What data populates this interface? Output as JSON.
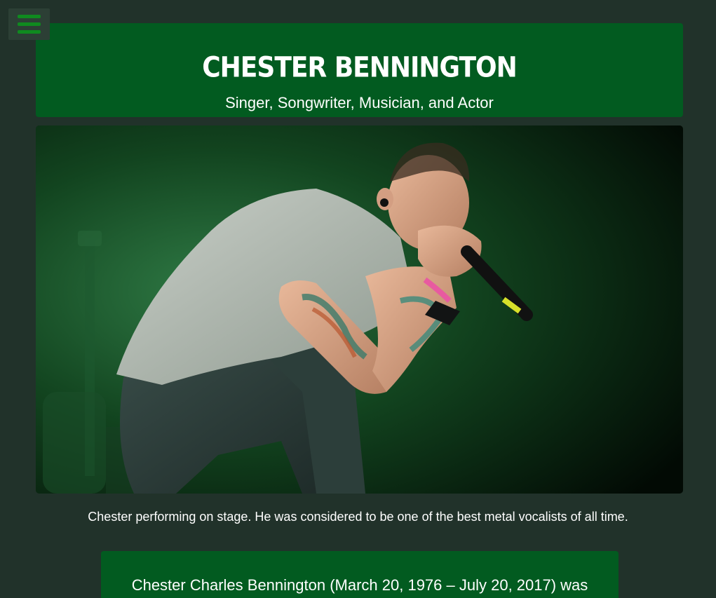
{
  "menu": {
    "icon": "hamburger-menu-icon",
    "accent_color": "#0f8a1f"
  },
  "header": {
    "title": "CHESTER BENNINGTON",
    "subtitle": "Singer, Songwriter, Musician, and Actor",
    "background_color": "#025b20"
  },
  "photo": {
    "subject": "singer-performing-on-stage"
  },
  "caption": "Chester performing on stage. He was considered to be one of the best metal vocalists of all time.",
  "bio": {
    "text": "Chester Charles Bennington (March 20, 1976 – July 20, 2017) was"
  },
  "theme": {
    "page_background": "#21322a",
    "card_background": "#025b20",
    "text_color": "#ffffff"
  }
}
